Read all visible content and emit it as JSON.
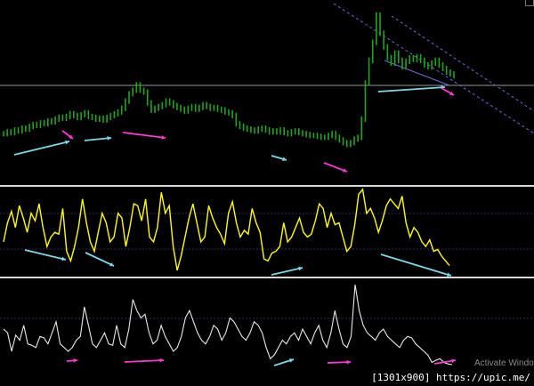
{
  "chart_data": [
    {
      "type": "candlestick",
      "title": "",
      "price_series": [
        44,
        46,
        45,
        48,
        47,
        50,
        49,
        52,
        54,
        53,
        56,
        55,
        58,
        57,
        60,
        62,
        61,
        63,
        66,
        64,
        62,
        65,
        67,
        63,
        62,
        60,
        61,
        59,
        62,
        64,
        66,
        68,
        72,
        80,
        88,
        92,
        98,
        92,
        90,
        78,
        70,
        72,
        74,
        76,
        80,
        78,
        75,
        73,
        71,
        69,
        72,
        74,
        71,
        73,
        76,
        74,
        72,
        73,
        71,
        70,
        68,
        67,
        64,
        55,
        52,
        50,
        49,
        48,
        47,
        49,
        50,
        48,
        46,
        47,
        46,
        48,
        45,
        44,
        46,
        47,
        45,
        44,
        43,
        42,
        42,
        41,
        40,
        40,
        42,
        44,
        40,
        37,
        34,
        32,
        34,
        38,
        40,
        60,
        100,
        125,
        145,
        175,
        155,
        140,
        128,
        122,
        133,
        125,
        118,
        124,
        128,
        126,
        129,
        125,
        120,
        118,
        122,
        125,
        120,
        116,
        112,
        110,
        108
      ],
      "color": "#1fa51f",
      "horizontal_line_level": 105,
      "trend_channel": "downward dashed channel",
      "grid": false
    },
    {
      "type": "line",
      "series": [
        {
          "values": [
            40,
            60,
            72,
            55,
            78,
            65,
            50,
            70,
            62,
            80,
            55,
            35,
            45,
            50,
            48,
            75,
            30,
            20,
            35,
            55,
            85,
            60,
            40,
            30,
            50,
            70,
            60,
            40,
            45,
            70,
            65,
            35,
            55,
            80,
            78,
            62,
            85,
            45,
            40,
            55,
            92,
            70,
            78,
            35,
            10,
            25,
            45,
            65,
            80,
            60,
            40,
            45,
            78,
            65,
            55,
            48,
            38,
            70,
            82,
            60,
            45,
            52,
            48,
            75,
            60,
            50,
            22,
            20,
            28,
            30,
            35,
            60,
            40,
            45,
            55,
            65,
            50,
            45,
            48,
            62,
            80,
            75,
            55,
            70,
            58,
            60,
            45,
            30,
            35,
            58,
            90,
            95,
            70,
            75,
            65,
            50,
            62,
            78,
            85,
            80,
            75,
            88,
            60,
            45,
            55,
            50,
            40,
            35,
            42,
            30,
            32,
            25,
            20,
            15
          ]
        }
      ],
      "color": "#ffff00",
      "grid": false
    },
    {
      "type": "line",
      "series": [
        {
          "values": [
            50,
            45,
            20,
            42,
            35,
            55,
            30,
            28,
            25,
            40,
            38,
            30,
            45,
            60,
            30,
            25,
            20,
            25,
            35,
            40,
            80,
            55,
            30,
            25,
            35,
            45,
            30,
            28,
            55,
            30,
            25,
            50,
            90,
            75,
            65,
            70,
            45,
            30,
            35,
            55,
            40,
            30,
            20,
            25,
            40,
            65,
            75,
            60,
            45,
            35,
            30,
            40,
            55,
            50,
            35,
            45,
            65,
            60,
            50,
            40,
            35,
            45,
            60,
            55,
            45,
            25,
            10,
            15,
            25,
            35,
            30,
            40,
            45,
            35,
            50,
            40,
            30,
            45,
            55,
            35,
            25,
            45,
            75,
            50,
            30,
            25,
            40,
            110,
            75,
            55,
            45,
            40,
            35,
            45,
            50,
            40,
            35,
            30,
            25,
            35,
            40,
            38,
            30,
            25,
            20,
            15,
            5,
            8,
            10,
            5,
            3,
            2
          ]
        }
      ],
      "color": "#e8e8e8",
      "grid": false
    }
  ],
  "annotations": {
    "cyan_color": "#7fd8e8",
    "magenta_color": "#ff3ad0"
  },
  "watermark_text": "Activate Window",
  "footer_text": "[1301x900] https://upic.me/"
}
